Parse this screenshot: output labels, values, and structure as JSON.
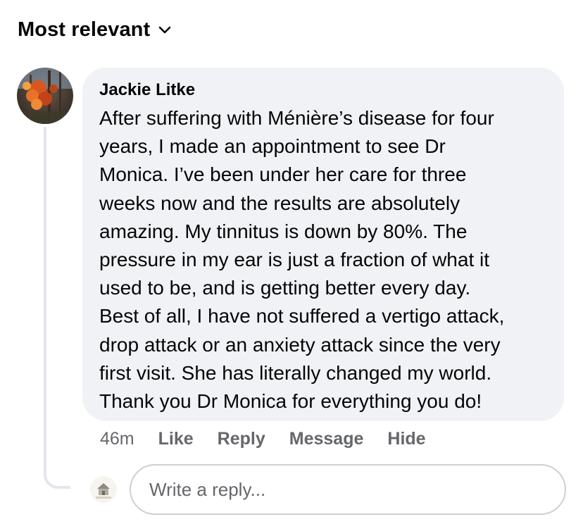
{
  "sort": {
    "label": "Most relevant",
    "icon": "chevron-down-icon"
  },
  "comment": {
    "author": "Jackie Litke",
    "text": "After suffering with Ménière’s disease for four\nyears, I made an appointment to see Dr\nMonica. I’ve been under her care for three\nweeks now and the results are absolutely\namazing. My tinnitus is down by 80%. The\npressure in my ear is just a fraction of what it\nused to be, and is getting better every day.\nBest of all, I have not suffered a vertigo attack,\ndrop attack or an anxiety attack since the very\nfirst visit.  She has literally changed my world.\nThank you Dr Monica for everything you do!",
    "time": "46m",
    "actions": {
      "like": "Like",
      "reply": "Reply",
      "message": "Message",
      "hide": "Hide"
    }
  },
  "reply": {
    "placeholder": "Write a reply...",
    "avatar_text": "COUNTRY"
  },
  "colors": {
    "bubble_bg": "#f0f2f5",
    "secondary_text": "#65676b",
    "primary_text": "#050505",
    "thread_line": "#e4e6eb"
  }
}
